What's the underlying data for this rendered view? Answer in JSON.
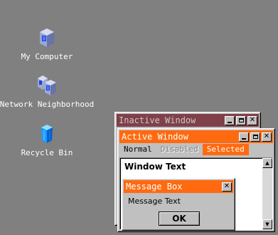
{
  "desktop": {
    "background": "#808080",
    "icons": [
      {
        "label": "My Computer",
        "icon": "computer-icon"
      },
      {
        "label": "Network Neighborhood",
        "icon": "network-icon"
      },
      {
        "label": "Recycle Bin",
        "icon": "recycle-bin-icon"
      }
    ]
  },
  "inactive_window": {
    "title": "Inactive Window",
    "title_color": "#80404a"
  },
  "active_window": {
    "title": "Active Window",
    "title_color": "#ff6a10",
    "menu": [
      {
        "label": "Normal",
        "state": "normal"
      },
      {
        "label": "Disabled",
        "state": "disabled"
      },
      {
        "label": "Selected",
        "state": "selected"
      }
    ],
    "body_text": "Window Text"
  },
  "message_box": {
    "title": "Message Box",
    "text": "Message Text",
    "ok_label": "OK"
  },
  "titlebar_buttons": {
    "minimize": "minimize-icon",
    "maximize": "maximize-icon",
    "close": "close-icon"
  }
}
